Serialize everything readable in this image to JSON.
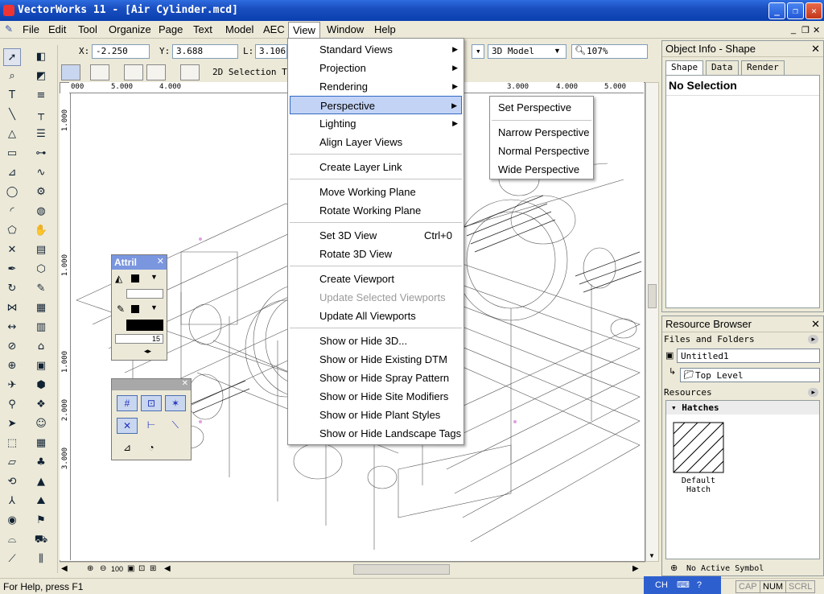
{
  "title": "VectorWorks 11 - [Air Cylinder.mcd]",
  "window_buttons": {
    "minimize": "_",
    "restore": "❐",
    "close": "✕"
  },
  "menubar": [
    "File",
    "Edit",
    "Tool",
    "Organize",
    "Page",
    "Text",
    "Model",
    "AEC",
    "View",
    "Window",
    "Help"
  ],
  "mdi_buttons": {
    "minimize": "_",
    "restore": "❐",
    "close": "✕"
  },
  "data_bar": {
    "x_label": "X:",
    "x_value": "-2.250",
    "y_label": "Y:",
    "y_value": "3.688",
    "l_label": "L:",
    "l_value": "3.106",
    "view_select": "3D Model",
    "zoom": "107%"
  },
  "mode_bar": {
    "label": "2D Selection Too"
  },
  "ruler_h": [
    "000",
    "5.000",
    "4.000",
    "3.000",
    "4.000",
    "5.000"
  ],
  "ruler_v": [
    "1.000",
    "1.000",
    "1.000",
    "2.000",
    "3.000"
  ],
  "view_menu": {
    "items": [
      {
        "label": "Standard Views",
        "submenu": true
      },
      {
        "label": "Projection",
        "submenu": true
      },
      {
        "label": "Rendering",
        "submenu": true
      },
      {
        "label": "Perspective",
        "submenu": true,
        "highlighted": true
      },
      {
        "label": "Lighting",
        "submenu": true
      },
      {
        "label": "Align Layer Views"
      },
      {
        "label": "Create Layer Link"
      },
      {
        "label": "Move Working Plane"
      },
      {
        "label": "Rotate Working Plane"
      },
      {
        "label": "Set 3D View",
        "shortcut": "Ctrl+0"
      },
      {
        "label": "Rotate 3D View"
      },
      {
        "label": "Create Viewport"
      },
      {
        "label": "Update Selected Viewports",
        "disabled": true
      },
      {
        "label": "Update All Viewports"
      },
      {
        "label": "Show or Hide 3D..."
      },
      {
        "label": "Show or Hide Existing DTM"
      },
      {
        "label": "Show or Hide Spray Pattern"
      },
      {
        "label": "Show or Hide Site Modifiers"
      },
      {
        "label": "Show or Hide Plant Styles"
      },
      {
        "label": "Show or Hide Landscape Tags"
      }
    ]
  },
  "perspective_submenu": [
    "Set Perspective",
    "Narrow Perspective",
    "Normal Perspective",
    "Wide Perspective"
  ],
  "object_info": {
    "title": "Object Info - Shape",
    "tabs": [
      "Shape",
      "Data",
      "Render"
    ],
    "status": "No Selection"
  },
  "resource_browser": {
    "title": "Resource Browser",
    "files_label": "Files and Folders",
    "file": "Untitled1",
    "level": "Top Level",
    "resources_label": "Resources",
    "group": "Hatches",
    "item": "Default Hatch",
    "symbol_status": "No Active Symbol"
  },
  "attr_palette": {
    "title": "Attril",
    "line_weight": "15"
  },
  "zoom_bar": {
    "zoom_value": "100"
  },
  "status": {
    "help": "For Help, press F1",
    "ime": "CH",
    "cap": "CAP",
    "num": "NUM",
    "scrl": "SCRL"
  },
  "colors": {
    "title_bar": "#0a3fb0",
    "menu_highlight": "#c3d3f5",
    "menu_border": "#316ac5",
    "panel_bg": "#ece9d8"
  }
}
